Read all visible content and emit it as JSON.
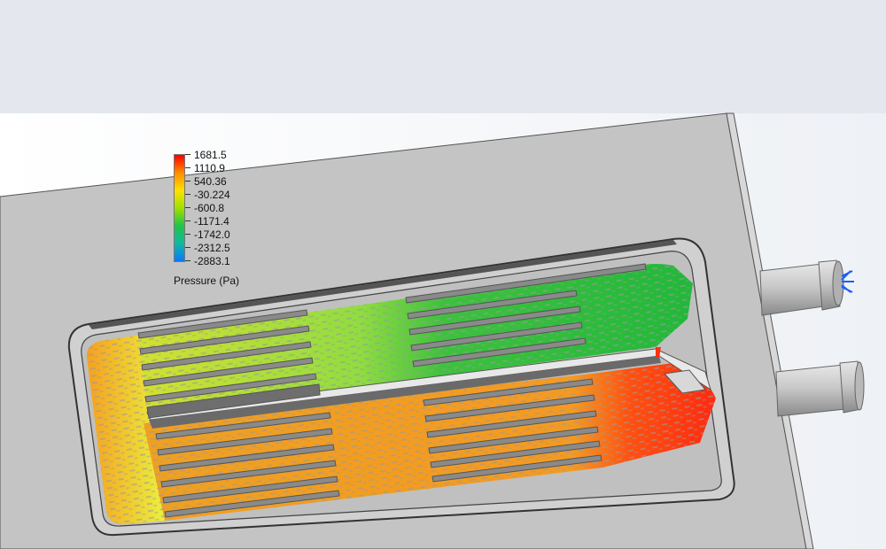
{
  "legend": {
    "title": "Pressure (Pa)",
    "labels": [
      "1681.5",
      "1110.9",
      "540.36",
      "-30.224",
      "-600.8",
      "-1171.4",
      "-1742.0",
      "-2312.5",
      "-2883.1"
    ],
    "colors": [
      "#ff0000",
      "#ff8c00",
      "#ffe000",
      "#a0e000",
      "#22c24a",
      "#12b8a0",
      "#0a78ff"
    ]
  },
  "colors": {
    "background_top": "#e4e8ee",
    "plate": "#c4c4c4",
    "cavity": "#d2d2d2",
    "red_zone": "#ff3010",
    "orange_zone": "#f5a020",
    "yellow_zone": "#eaea30",
    "green_zone": "#30c030",
    "light_green_zone": "#88dd40",
    "fins": "#707070",
    "inlet_arrows": "#1a5cff"
  }
}
